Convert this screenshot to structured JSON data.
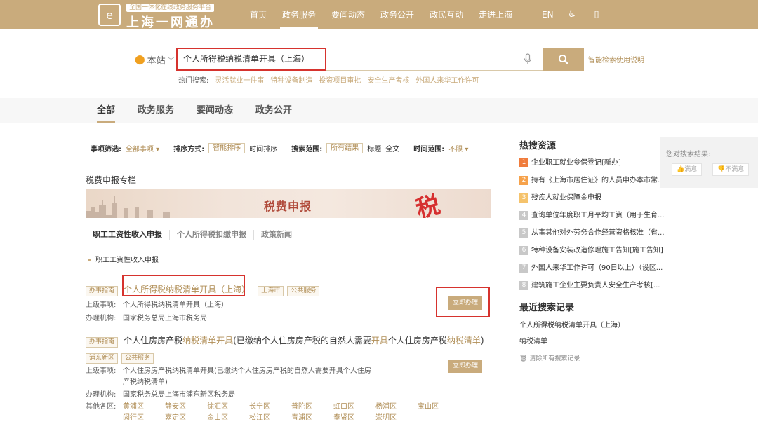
{
  "header": {
    "logo_subtitle": "全国一体化在线政务服务平台",
    "logo_title": "上海一网通办",
    "nav": [
      "首页",
      "政务服务",
      "要闻动态",
      "政务公开",
      "政民互动",
      "走进上海"
    ],
    "active_nav_index": 1,
    "lang": "EN",
    "icons": [
      "accessibility-icon",
      "mobile-icon"
    ],
    "accent_color": "#c9ab7c"
  },
  "search": {
    "scope_label": "本站",
    "query": "个人所得税纳税清单开具（上海）",
    "help_link": "智能检索使用说明",
    "hot_label": "热门搜索:",
    "hot_items": [
      "灵活就业一件事",
      "特种设备制造",
      "投资项目审批",
      "安全生产考核",
      "外国人来华工作许可"
    ]
  },
  "tabs": [
    "全部",
    "政务服务",
    "要闻动态",
    "政务公开"
  ],
  "filters": {
    "item_filter_label": "事项筛选:",
    "item_filter_value": "全部事项",
    "sort_label": "排序方式:",
    "sort_options": [
      "智能排序",
      "时间排序"
    ],
    "scope_label": "搜索范围:",
    "scope_options": [
      "所有结果",
      "标题",
      "全文"
    ],
    "time_label": "时间范围:",
    "time_value": "不限"
  },
  "column": {
    "title": "税费申报专栏",
    "banner_text": "税费申报",
    "banner_char": "税",
    "subtabs": [
      "职工工资性收入申报",
      "个人所得税扣缴申报",
      "政策新闻"
    ],
    "list_item": "职工工资性收入申报"
  },
  "results": [
    {
      "tag": "办事指南",
      "title": "个人所得税纳税清单开具（上海）",
      "badges": [
        "上海市",
        "公共服务"
      ],
      "parent_label": "上级事项:",
      "parent_value": "个人所得税纳税清单开具（上海）",
      "org_label": "办理机构:",
      "org_value": "国家税务总局上海市税务局",
      "button": "立即办理"
    },
    {
      "tag": "办事指南",
      "title_parts": [
        "个人住房房产税",
        "纳税清单",
        "开具",
        "(已缴纳个人住房房产税的自然人需要",
        "开具",
        "个人住房房产税",
        "纳税清单",
        ")"
      ],
      "badges": [
        "浦东新区",
        "公共服务"
      ],
      "parent_label": "上级事项:",
      "parent_value_line1": "个人住房房产税纳税清单开具(已缴纳个人住房房产税的自然人需要开具个人住房",
      "parent_value_line2": "产税纳税清单)",
      "org_label": "办理机构:",
      "org_value": "国家税务总局上海市浦东新区税务局",
      "other_label": "其他各区:",
      "districts": [
        "黄浦区",
        "静安区",
        "徐汇区",
        "长宁区",
        "普陀区",
        "虹口区",
        "杨浦区",
        "宝山区",
        "闵行区",
        "嘉定区",
        "金山区",
        "松江区",
        "青浦区",
        "奉贤区",
        "崇明区"
      ],
      "button": "立即办理"
    }
  ],
  "hot_resources": {
    "title": "热搜资源",
    "items": [
      "企业职工就业参保登记[新办]",
      "持有《上海市居住证》的人员申办本市常...",
      "残疾人就业保障金申报",
      "查询单位年度职工月平均工资（用于生育...",
      "从事其他对外劳务合作经营资格核准（省...",
      "特种设备安装改造修理施工告知[施工告知]",
      "外国人来华工作许可（90日以上）（设区...",
      "建筑施工企业主要负责人安全生产考核[..."
    ]
  },
  "recent": {
    "title": "最近搜索记录",
    "items": [
      "个人所得税纳税清单开具（上海）",
      "纳税清单"
    ],
    "clear": "清除所有搜索记录"
  },
  "feedback": {
    "title": "您对搜索结果:",
    "satisfied": "满意",
    "unsatisfied": "不满意"
  }
}
